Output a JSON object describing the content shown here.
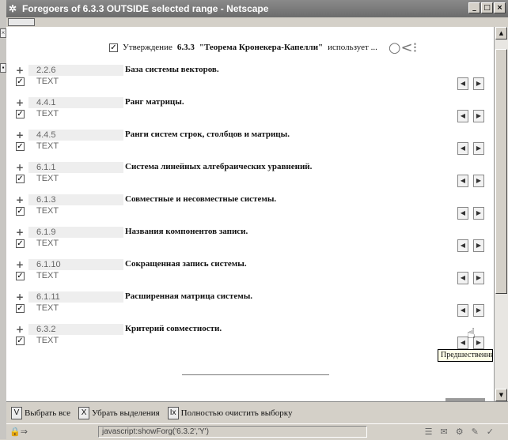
{
  "window": {
    "title": "Foregoers of 6.3.3 OUTSIDE selected range - Netscape",
    "min": "_",
    "max": "□",
    "close": "×"
  },
  "header": {
    "prefix": "Утверждение",
    "id": "6.3.3",
    "name": "\"Теорема Кронекера-Капелли\"",
    "suffix": "использует ..."
  },
  "rows": [
    {
      "num": "2.2.6",
      "kind": "TEXT",
      "title": "База системы векторов."
    },
    {
      "num": "4.4.1",
      "kind": "TEXT",
      "title": "Ранг матрицы."
    },
    {
      "num": "4.4.5",
      "kind": "TEXT",
      "title": "Ранги систем строк, столбцов и матрицы."
    },
    {
      "num": "6.1.1",
      "kind": "TEXT",
      "title": "Система линейных алгебраических уравнений."
    },
    {
      "num": "6.1.3",
      "kind": "TEXT",
      "title": "Совместные и несовместные системы."
    },
    {
      "num": "6.1.9",
      "kind": "TEXT",
      "title": "Названия компонентов записи."
    },
    {
      "num": "6.1.10",
      "kind": "TEXT",
      "title": "Сокращенная запись системы."
    },
    {
      "num": "6.1.11",
      "kind": "TEXT",
      "title": "Расширенная матрица системы."
    },
    {
      "num": "6.3.2",
      "kind": "TEXT",
      "title": "Критерий совместности."
    }
  ],
  "tooltip": "Предшественники (",
  "bottom": {
    "select_all_key": "V",
    "select_all": "Выбрать все",
    "clear_sel_key": "X",
    "clear_sel": "Убрать выделения",
    "clear_all_key": "Ix",
    "clear_all": "Полностью очистить выборку"
  },
  "status": {
    "url": "javascript:showForg('6.3.2','Y')"
  }
}
